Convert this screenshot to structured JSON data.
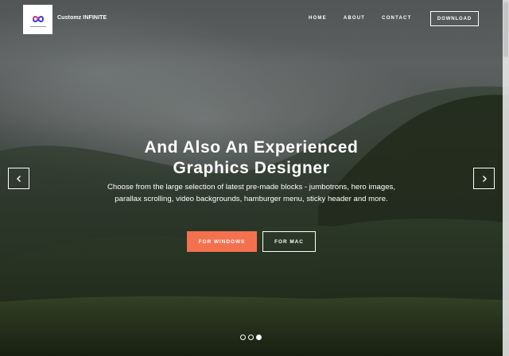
{
  "brand": {
    "name": "Customz INFINITE",
    "logo_icon": "infinity-logo-icon",
    "logo_colors": [
      "#e23d6e",
      "#3c3ad8"
    ]
  },
  "nav": {
    "items": [
      "HOME",
      "ABOUT",
      "CONTACT"
    ],
    "download_label": "DOWNLOAD"
  },
  "hero": {
    "title_line1": "And Also An Experienced",
    "title_line2": "Graphics Designer",
    "subtitle": "Choose from the large selection of latest pre-made blocks - jumbotrons, hero images, parallax scrolling, video backgrounds, hamburger menu, sticky header and more.",
    "buttons": {
      "windows": "FOR WINDOWS",
      "mac": "FOR MAC"
    }
  },
  "carousel": {
    "prev_icon": "chevron-left-icon",
    "next_icon": "chevron-right-icon",
    "slide_count": 3,
    "active_slide": 3
  },
  "colors": {
    "accent": "#f4714f",
    "text": "#ffffff"
  }
}
